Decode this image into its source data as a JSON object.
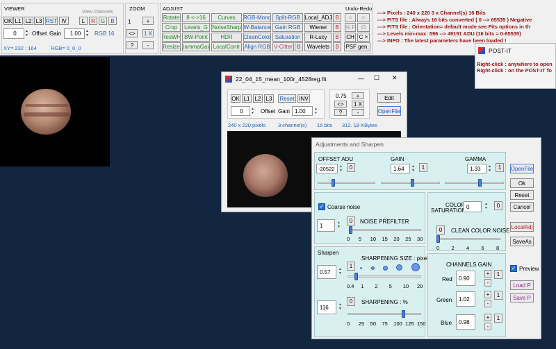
{
  "viewer": {
    "title": "VIEWER",
    "view_channels": "View channels",
    "buttons": [
      "OK",
      "L1",
      "L2",
      "L3",
      "RST",
      "IV"
    ],
    "channels": [
      "L",
      "R",
      "G",
      "B"
    ],
    "offset_value": "0",
    "offset_label": "Offset",
    "gain_label": "Gain",
    "gain_value": "1.00",
    "rgb_label": "RGB 16",
    "xy": "XY= 232 : 164",
    "rgb_val": "RGB= 0_0_0"
  },
  "zoom": {
    "title": "ZOOM",
    "value": "1",
    "plus": "+",
    "swap": "<>",
    "onex": "1 X",
    "help": "?",
    "minus": "-"
  },
  "adjust": {
    "title": "ADJUST",
    "undo_title": "Undo-Redo",
    "row1": [
      "Rotate",
      "8 <->16",
      "Curves",
      "RGB-Mono",
      "Split-RGB",
      "Local_ADJ",
      "B"
    ],
    "row2": [
      "Crop",
      "Levels_G",
      "NoiseSharp",
      "W-Balance",
      "Gain RGB",
      "Wiener",
      "B"
    ],
    "row3": [
      "ResWH",
      "BW-Point",
      "HDR",
      "CleanColor",
      "Saturation",
      "R-Lucy",
      "B"
    ],
    "row4": [
      "Resize",
      "GammaGain",
      "LocalContr",
      "Align RGB",
      "V-Citter",
      "B",
      "Wavelets",
      "B",
      "PSF gen."
    ],
    "undo": [
      "<",
      ">",
      "% F",
      "O",
      "CH",
      "C >"
    ]
  },
  "info": {
    "lines": [
      "---> Pixels   :  240 x 220     3 x Channel(s)     16 Bits",
      "---> FITS file :  Always 16 bits converted ( 0 --> 65535 )   Negative",
      "---> FITS file :  Orientation=  default mode    see Fits options  in th",
      "---> Levels min-max:  596 --> 49191 ADU  (16 bits = 0-65535)",
      "---> INFO :   The latest parameters have been loaded !"
    ]
  },
  "postit": {
    "title": "POST-IT",
    "line1": "Right-click : anywhere to open",
    "line2": "Right-click : on the POST-IT fo"
  },
  "image_window": {
    "title": "22_04_15_mean_100r_4528reg.fit",
    "minimize": "—",
    "maximize": "☐",
    "close": "✕",
    "buttons": [
      "OK",
      "L1",
      "L2",
      "L3",
      "Reset",
      "INV"
    ],
    "offset_value": "0",
    "offset_label": "Offset",
    "gain_label": "Gain",
    "gain_value": "1.00",
    "zoom": "0.75",
    "plus": "+",
    "swap": "<>",
    "onex": "1 X",
    "help": "?",
    "minus": "-",
    "edit": "Edit",
    "openfile": "OpenFile",
    "status": [
      "240  x  220  pixels",
      "3  channel(s)",
      "16 bits",
      "312. 18 KBytes"
    ]
  },
  "adj_window": {
    "title": "Adjustments and Sharpen",
    "offset": {
      "label": "OFFSET ADU",
      "value": "-20522",
      "btn": "0"
    },
    "gain": {
      "label": "GAIN",
      "value": "1.64",
      "btn": "1"
    },
    "gamma": {
      "label": "GAMMA",
      "value": "1.33",
      "btn": "1"
    },
    "side_buttons": [
      "OpenFile",
      "Ok",
      "Reset",
      "Cancel",
      "LocalAdj",
      "SaveAs"
    ],
    "coarse_noise": "Coarse noise",
    "noise_value": "1",
    "noise_btn": "0",
    "noise_label": "NOISE PREFILTER",
    "noise_ticks": [
      "0",
      "5",
      "10",
      "15",
      "20",
      "25",
      "30"
    ],
    "color_sat_label1": "COLOR",
    "color_sat_label2": "SATURATION",
    "color_sat_value": "0",
    "color_sat_btn": "0",
    "clean_btn": "0",
    "clean_label": "CLEAN COLOR NOISE",
    "clean_ticks": [
      "0",
      "2",
      "4",
      "6",
      "8"
    ],
    "sharpen_title": "Sharpen",
    "sharp_size_value": "0.57",
    "sharp_size_btn": "1",
    "sharp_size_label": "SHARPENING SIZE : pixels",
    "size_ticks": [
      "0.4",
      "1",
      "2",
      "5",
      "10",
      "20"
    ],
    "sharp_pct_value": "116",
    "sharp_pct_btn": "0",
    "sharp_pct_label": "SHARPENING : %",
    "pct_ticks": [
      "0",
      "25",
      "50",
      "75",
      "100",
      "125",
      "150"
    ],
    "channels_title": "CHANNELS GAIN",
    "channels": [
      {
        "name": "Red",
        "value": "0.90"
      },
      {
        "name": "Green",
        "value": "1.02"
      },
      {
        "name": "Blue",
        "value": "0.98"
      }
    ],
    "chan_btn": "1",
    "preview": "Preview",
    "load": "Load P",
    "save": "Save P"
  }
}
